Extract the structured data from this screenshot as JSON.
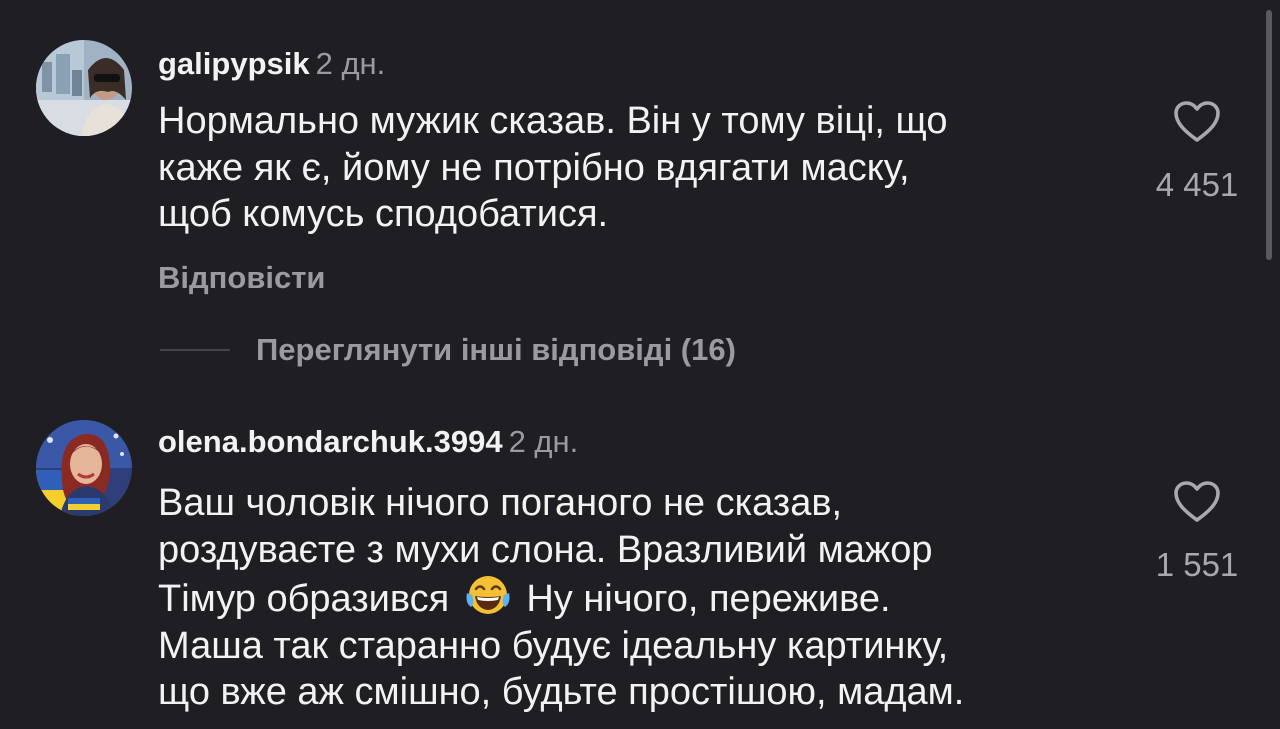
{
  "comments": [
    {
      "username": "galipypsik",
      "time": "2 дн.",
      "text": "Нормально мужик сказав. Він у тому віці, що\nкаже як є, йому не потрібно вдягати маску,\nщоб комусь сподобатися.",
      "reply_label": "Відповісти",
      "like_count": "4 451",
      "avatar_icon": "user-photo-avatar"
    },
    {
      "username": "olena.bondarchuk.3994",
      "time": "2 дн.",
      "text_before_emoji": "Ваш чоловік нічого поганого не сказав,\nроздуваєте з мухи слона. Вразливий мажор\nТімур образився ",
      "emoji": "laughing-tears-emoji",
      "text_after_emoji": " Ну нічого, переживе.\nМаша так старанно будує ідеальну картинку,\nщо вже аж смішно, будьте простішою, мадам.",
      "like_count": "1 551",
      "avatar_icon": "user-photo-avatar"
    }
  ],
  "view_replies_label": "Переглянути інші відповіді (16)",
  "colors": {
    "background": "#1f1f23",
    "text_primary": "#f2f2f2",
    "text_secondary": "#9a9aa0"
  }
}
